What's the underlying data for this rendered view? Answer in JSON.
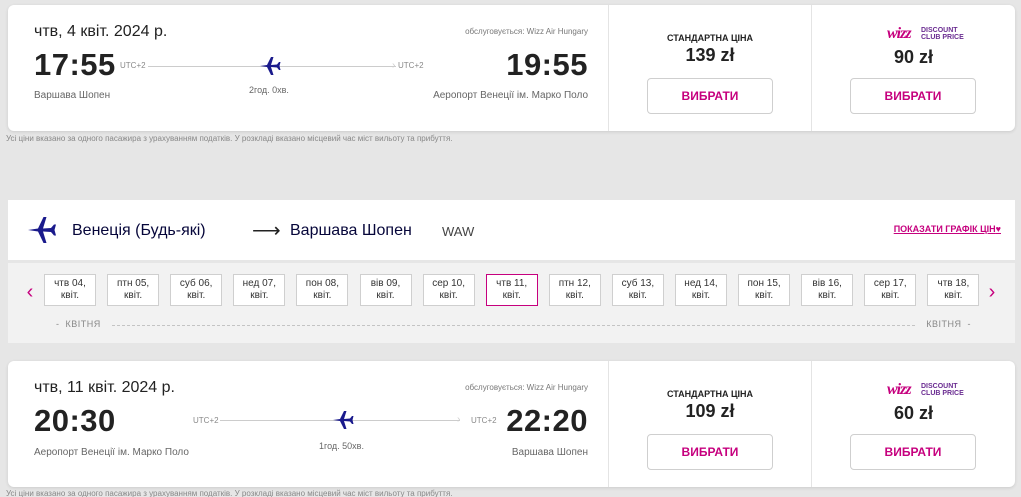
{
  "flight1": {
    "date": "чтв, 4 квіт. 2024 р.",
    "operated": "обслуговується: Wizz Air Hungary",
    "dep_time": "17:55",
    "dep_utc": "UTC+2",
    "arr_utc": "UTC+2",
    "arr_time": "19:55",
    "dep_airport": "Варшава Шопен",
    "duration": "2год. 0хв.",
    "arr_airport": "Аеропорт Венеції ім. Марко Поло",
    "std_label": "СТАНДАРТНА ЦІНА",
    "std_price": "139 zł",
    "wdc_price": "90 zł",
    "select_label": "ВИБРАТИ"
  },
  "note": "Усі ціни вказано за одного пасажира з урахуванням податків. У розкладі вказано місцевий час міст вильоту та прибуття.",
  "wdc_logo": {
    "wizz": "wizz",
    "line1": "DISCOUNT",
    "line2": "CLUB PRICE"
  },
  "route": {
    "from": "Венеція (Будь-які)",
    "arrow": "⟶",
    "to": "Варшава Шопен",
    "code": "WAW",
    "show_graph": "ПОКАЗАТИ ГРАФІК ЦІН",
    "heart": "♥"
  },
  "date_nav": {
    "prev": "‹",
    "next": "›",
    "days": [
      {
        "l1": "чтв 04,",
        "l2": "квіт."
      },
      {
        "l1": "птн 05,",
        "l2": "квіт."
      },
      {
        "l1": "суб 06,",
        "l2": "квіт."
      },
      {
        "l1": "нед 07,",
        "l2": "квіт."
      },
      {
        "l1": "пон 08,",
        "l2": "квіт."
      },
      {
        "l1": "вів 09,",
        "l2": "квіт."
      },
      {
        "l1": "сер 10,",
        "l2": "квіт."
      },
      {
        "l1": "чтв 11,",
        "l2": "квіт."
      },
      {
        "l1": "птн 12,",
        "l2": "квіт."
      },
      {
        "l1": "суб 13,",
        "l2": "квіт."
      },
      {
        "l1": "нед 14,",
        "l2": "квіт."
      },
      {
        "l1": "пон 15,",
        "l2": "квіт."
      },
      {
        "l1": "вів 16,",
        "l2": "квіт."
      },
      {
        "l1": "сер 17,",
        "l2": "квіт."
      },
      {
        "l1": "чтв 18,",
        "l2": "квіт."
      }
    ],
    "selected_index": 7,
    "month_left": "КВІТНЯ",
    "month_right": "КВІТНЯ"
  },
  "flight2": {
    "date": "чтв, 11 квіт. 2024 р.",
    "operated": "обслуговується: Wizz Air Hungary",
    "dep_time": "20:30",
    "dep_utc": "UTC+2",
    "arr_utc": "UTC+2",
    "arr_time": "22:20",
    "dep_airport": "Аеропорт Венеції ім. Марко Поло",
    "duration": "1год. 50хв.",
    "arr_airport": "Варшава Шопен",
    "std_label": "СТАНДАРТНА ЦІНА",
    "std_price": "109 zł",
    "wdc_price": "60 zł",
    "select_label": "ВИБРАТИ"
  },
  "colors": {
    "brand": "#c6007e",
    "navy": "#06063a",
    "plane": "#1a1a8c"
  },
  "icons": {
    "plane": "plane-icon",
    "route": "route-plane-icon"
  }
}
